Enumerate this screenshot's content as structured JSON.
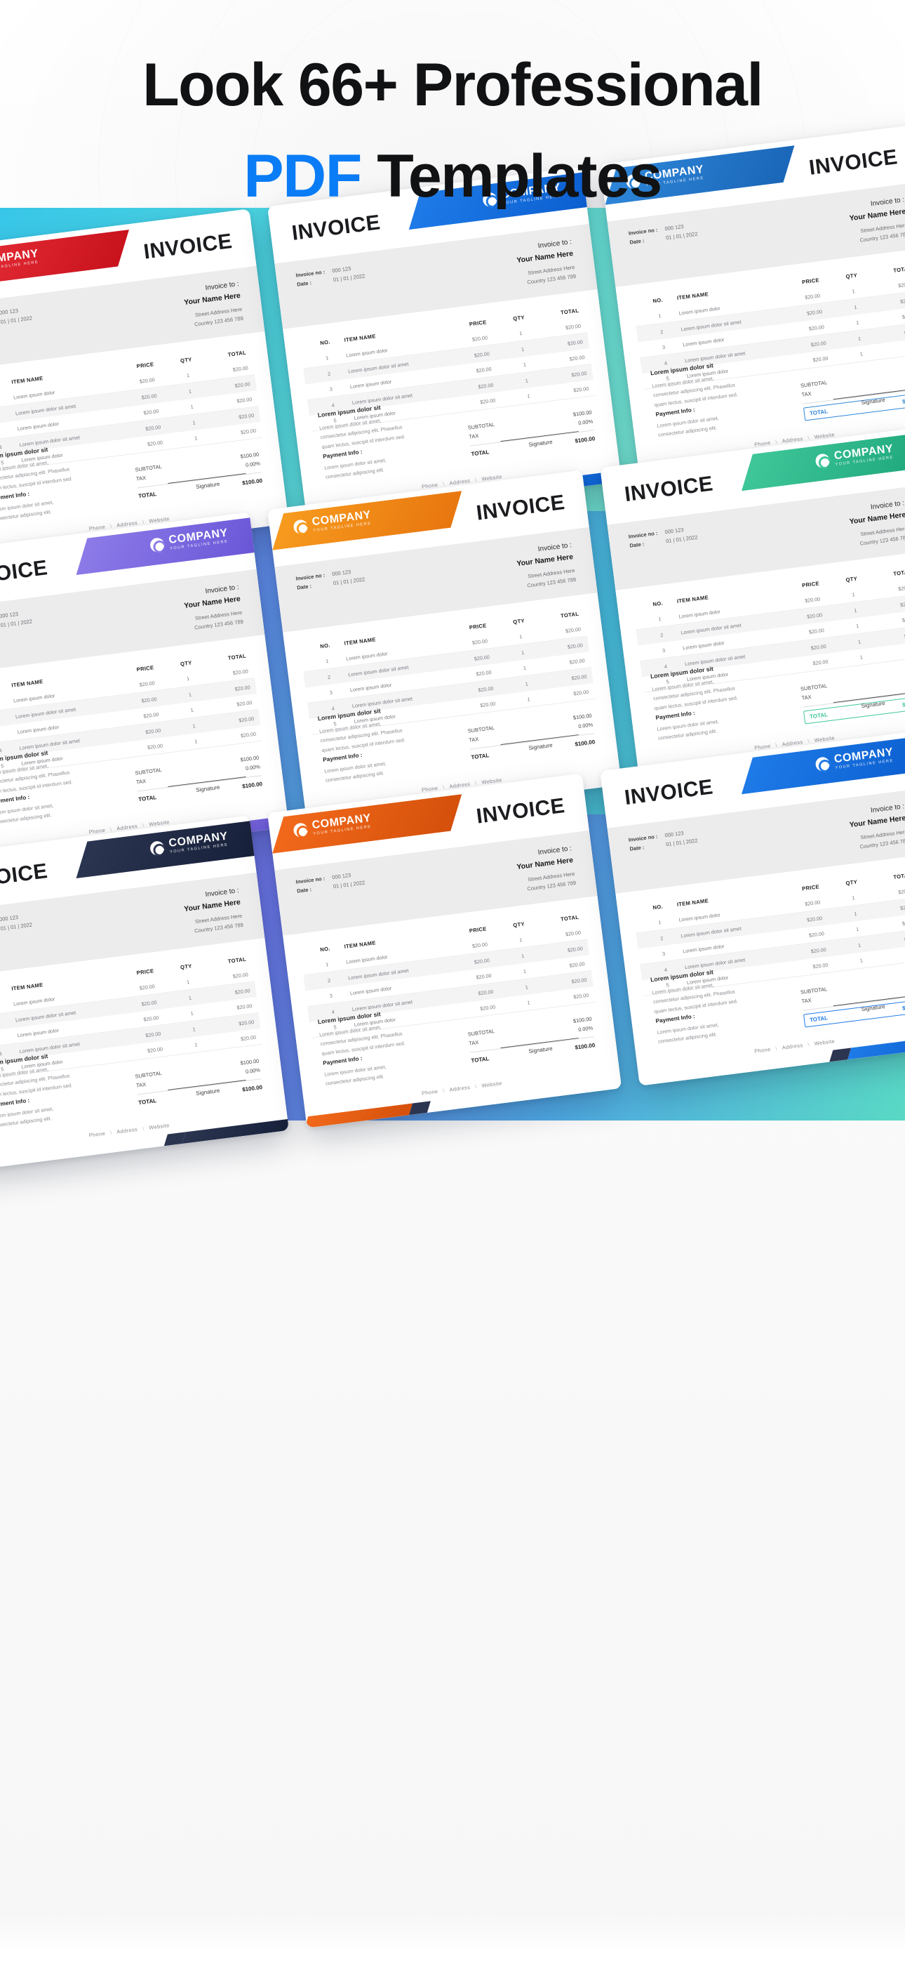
{
  "headline": {
    "line1": "Look 66+ Professional",
    "accent": "PDF",
    "line2_rest": " Templates",
    "accent_color": "#0A7CF5",
    "text_color": "#111214"
  },
  "invoice": {
    "brand_name": "COMPANY",
    "brand_tagline": "YOUR TAGLINE HERE",
    "title": "INVOICE",
    "invoice_no_label": "Invoice no :",
    "invoice_no_value": "000 123",
    "date_label": "Date :",
    "date_value": "01 | 01 | 2022",
    "bill_to_label": "Invoice to :",
    "bill_to_name": "Your Name Here",
    "bill_to_line1": "Street Address Here",
    "bill_to_line2": "Country 123 456 789",
    "columns": [
      "NO.",
      "ITEM NAME",
      "PRICE",
      "QTY",
      "TOTAL"
    ],
    "rows": [
      {
        "no": "1",
        "item": "Lorem ipsum dolor",
        "price": "$20.00",
        "qty": "1",
        "total": "$20.00"
      },
      {
        "no": "2",
        "item": "Lorem ipsum dolor sit amet",
        "price": "$20.00",
        "qty": "1",
        "total": "$20.00"
      },
      {
        "no": "3",
        "item": "Lorem ipsum dolor",
        "price": "$20.00",
        "qty": "1",
        "total": "$20.00"
      },
      {
        "no": "4",
        "item": "Lorem ipsum dolor sit amet",
        "price": "$20.00",
        "qty": "1",
        "total": "$20.00"
      },
      {
        "no": "5",
        "item": "Lorem ipsum dolor",
        "price": "$20.00",
        "qty": "1",
        "total": "$20.00"
      }
    ],
    "subtotal_label": "SUBTOTAL",
    "subtotal_value": "$100.00",
    "tax_label": "TAX",
    "tax_value": "0.00%",
    "total_label": "TOTAL",
    "total_value": "$100.00",
    "notes_title": "Lorem ipsum dolor sit",
    "notes_l1": "Lorem ipsum dolor sit amet,",
    "notes_l2": "consectetur adipiscing elit. Phasellus",
    "notes_l3": "quam lectus, suscipit id interdum sed.",
    "payment_title": "Payment Info :",
    "payment_l1": "Lorem ipsum dolor sit amet,",
    "payment_l2": "consectetur adipiscing elit.",
    "signature_label": "Signature",
    "footer_phone": "Phone",
    "footer_address": "Address",
    "footer_website": "Website",
    "footer_sep": "\\"
  },
  "themes": [
    {
      "name": "red",
      "accent": "#E8303A",
      "accent2": "#C8121C",
      "align": "left"
    },
    {
      "name": "blue",
      "accent": "#1E7BE8",
      "accent2": "#0C5FD0",
      "align": "right"
    },
    {
      "name": "violet",
      "accent": "#8C7BE8",
      "accent2": "#6A57D8",
      "align": "right"
    },
    {
      "name": "orange",
      "accent": "#F79B1E",
      "accent2": "#E8760F",
      "align": "left"
    },
    {
      "name": "azure",
      "accent": "#2E86D8",
      "accent2": "#1A66B8",
      "align": "left"
    },
    {
      "name": "mint",
      "accent": "#3FC79A",
      "accent2": "#1FA87C",
      "align": "right"
    },
    {
      "name": "navy",
      "accent": "#2B3550",
      "accent2": "#17203A",
      "align": "right"
    },
    {
      "name": "tangerine",
      "accent": "#F2691B",
      "accent2": "#D4500B",
      "align": "left"
    }
  ],
  "bands": {
    "band_a": "#38c6e8",
    "band_b": "#6f6ce0",
    "band_c": "#7f6be2"
  }
}
